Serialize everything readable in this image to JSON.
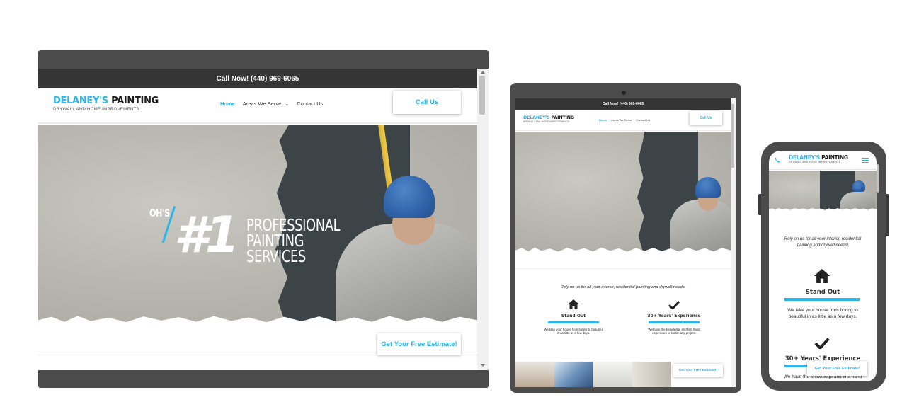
{
  "site": {
    "logo_main": "DELANEY'S",
    "logo_main_accent": "PAINTING",
    "logo_sub": "DRYWALL AND HOME IMPROVEMENTS",
    "call_now": "Call Now! (440) 969-6065",
    "nav": {
      "home": "Home",
      "areas": "Areas We Serve",
      "contact": "Contact Us"
    },
    "call_button": "Call Us",
    "estimate_button": "Get Your Free Estimate!",
    "hero": {
      "prefix": "OH'S",
      "number": "#1",
      "line1": "PROFESSIONAL",
      "line2": "PAINTING",
      "line3": "SERVICES"
    },
    "tagline": "Rely on us for all your interior, residential painting and drywall needs!",
    "features": [
      {
        "icon": "home-icon",
        "title": "Stand Out",
        "text": "We take your house from boring to beautiful in as little as a few days."
      },
      {
        "icon": "checkmark-icon",
        "title": "30+ Years' Experience",
        "text": "We have the knowledge and first hand experience to tackle any project."
      }
    ]
  },
  "colors": {
    "accent": "#2db4e8",
    "frame": "#4b4b4b",
    "topbar": "#353535"
  },
  "icons": {
    "phone": "phone-icon",
    "menu": "hamburger-menu-icon",
    "dropdown": "chevron-down-icon"
  }
}
